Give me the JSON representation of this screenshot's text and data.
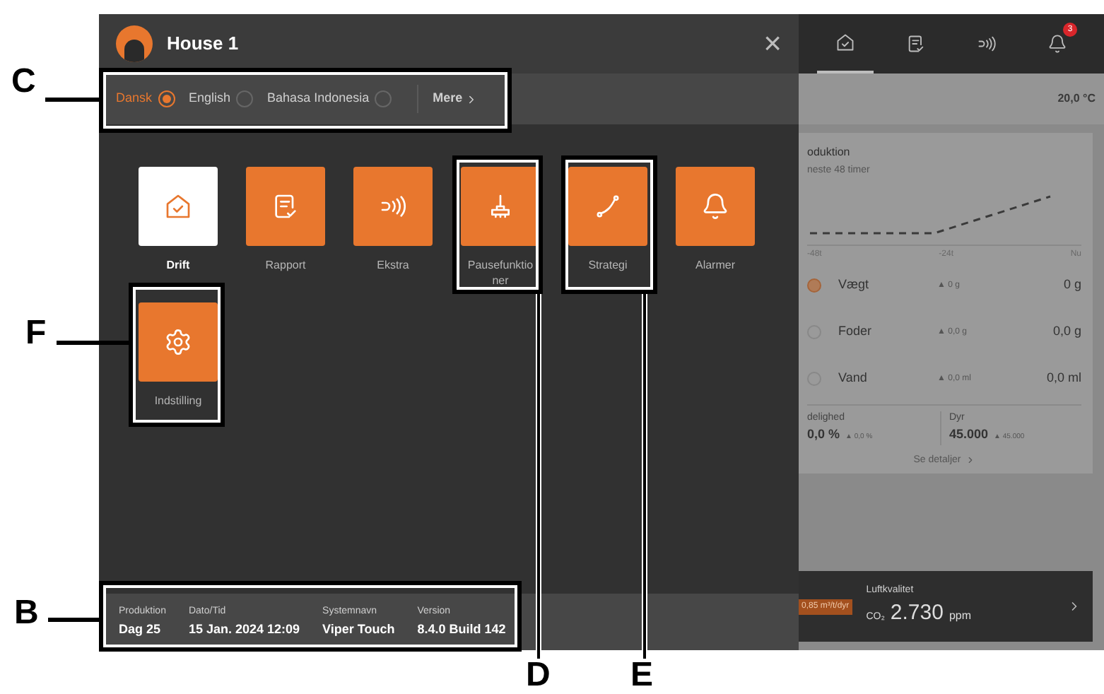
{
  "window": {
    "title": "House 1",
    "close": "×"
  },
  "languages": [
    {
      "label": "Dansk",
      "selected": true
    },
    {
      "label": "English",
      "selected": false
    },
    {
      "label": "Bahasa Indonesia",
      "selected": false
    }
  ],
  "more": "Mere",
  "tiles": [
    {
      "kind": "drift",
      "label": "Drift",
      "selected": true
    },
    {
      "kind": "report",
      "label": "Rapport",
      "selected": false
    },
    {
      "kind": "extra",
      "label": "Ekstra",
      "selected": false
    },
    {
      "kind": "pause",
      "label": "Pausefunktioner",
      "selected": false
    },
    {
      "kind": "strategy",
      "label": "Strategi",
      "selected": false
    },
    {
      "kind": "alarm",
      "label": "Alarmer",
      "selected": false
    },
    {
      "kind": "settings",
      "label": "Indstilling",
      "selected": false
    }
  ],
  "footer": [
    {
      "label": "Produktion",
      "value": "Dag 25"
    },
    {
      "label": "Dato/Tid",
      "value": "15 Jan. 2024 12:09"
    },
    {
      "label": "Systemnavn",
      "value": "Viper Touch"
    },
    {
      "label": "Version",
      "value": "8.4.0 Build 142"
    }
  ],
  "background": {
    "nav": [
      {
        "kind": "drift",
        "selected": true
      },
      {
        "kind": "report",
        "selected": false
      },
      {
        "kind": "extra",
        "selected": false
      },
      {
        "kind": "alarm",
        "selected": false,
        "badge": "3"
      }
    ],
    "temperature": "20,0 °C",
    "chart_title": "oduktion",
    "chart_subtitle": "neste 48 timer",
    "chart_labels": [
      "-48t",
      "-24t",
      "Nu"
    ],
    "rows": [
      {
        "name": "Vægt",
        "delta": "▲ 0 g",
        "value": "0 g",
        "selected": true
      },
      {
        "name": "Foder",
        "delta": "▲ 0,0 g",
        "value": "0,0 g",
        "selected": false
      },
      {
        "name": "Vand",
        "delta": "▲ 0,0 ml",
        "value": "0,0 ml",
        "selected": false
      }
    ],
    "stats": [
      {
        "label": "delighed",
        "value": "0,0 %",
        "delta": "▲ 0,0 %"
      },
      {
        "label": "Dyr",
        "value": "45.000",
        "delta": "▲ 45.000"
      }
    ],
    "details": "Se detaljer",
    "ventilation": "0,85 m³/t/dyr",
    "air": {
      "label": "Luftkvalitet",
      "gas": "CO₂",
      "value": "2.730",
      "unit": "ppm"
    }
  },
  "annotations": [
    {
      "letter": "C"
    },
    {
      "letter": "F"
    },
    {
      "letter": "B"
    },
    {
      "letter": "D"
    },
    {
      "letter": "E"
    }
  ]
}
